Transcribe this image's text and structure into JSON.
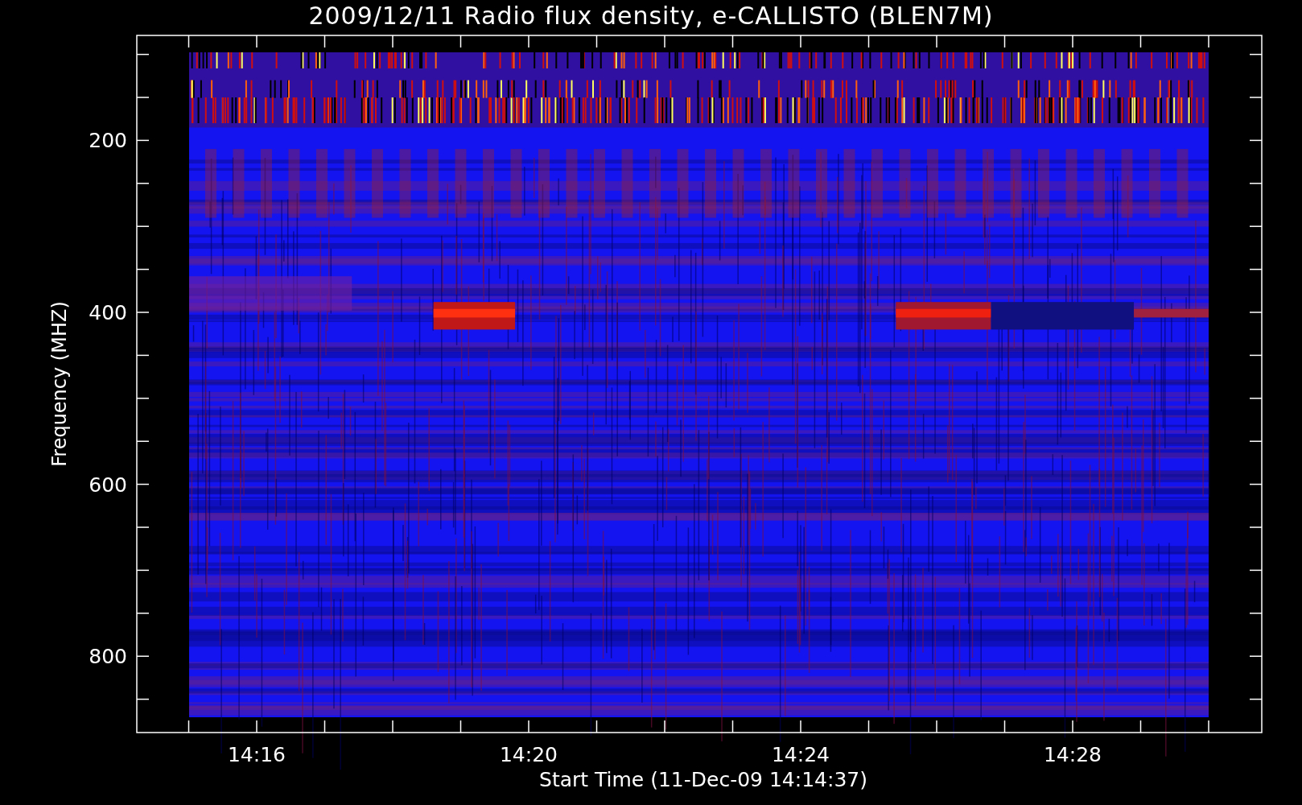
{
  "title": "2009/12/11  Radio flux density, e-CALLISTO (BLEN7M)",
  "y_axis": {
    "label": "Frequency (MHZ)",
    "ticks": [
      "200",
      "400",
      "600",
      "800"
    ]
  },
  "x_axis": {
    "label": "Start Time (11-Dec-09 14:14:37)",
    "ticks": [
      "14:16",
      "14:20",
      "14:24",
      "14:28"
    ]
  }
}
